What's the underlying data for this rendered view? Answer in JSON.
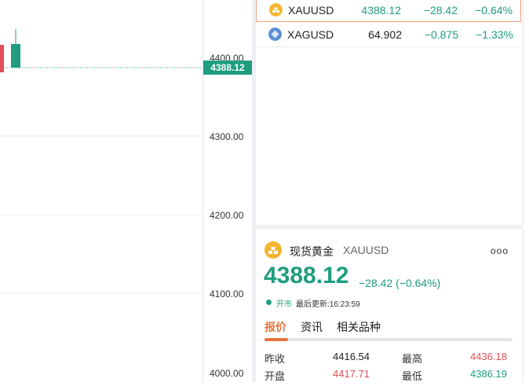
{
  "chart": {
    "axis_ticks": [
      "4300.00",
      "4200.00",
      "4100.00"
    ],
    "partial_top_tick": "4400.00",
    "partial_bottom_tick": "4000.00",
    "current_price_label": "4388.12",
    "colors": {
      "up": "#1f9d7f",
      "down": "#e0505a"
    }
  },
  "watchlist": {
    "rows": [
      {
        "symbol": "XAUUSD",
        "price": "4388.12",
        "change": "−28.42",
        "pct": "−0.64%",
        "icon": "gold-bars-icon",
        "selected": true
      },
      {
        "symbol": "XAGUSD",
        "price": "64.902",
        "change": "−0.875",
        "pct": "−1.33%",
        "icon": "silver-diamond-icon",
        "selected": false
      }
    ]
  },
  "detail": {
    "name": "现货黄金",
    "symbol": "XAUUSD",
    "more": "ooo",
    "price": "4388.12",
    "change": "−28.42 (−0.64%)",
    "status": "开市",
    "updated": "最后更新:16:23:59",
    "tabs": [
      "报价",
      "资讯",
      "相关品种"
    ],
    "quotes": [
      {
        "label": "昨收",
        "value": "4416.54"
      },
      {
        "label": "最高",
        "value": "4436.18"
      },
      {
        "label": "开盘",
        "value": "4417.71"
      },
      {
        "label": "最低",
        "value": "4386.19"
      }
    ],
    "colors": {
      "accent": "#e8743b",
      "up": "#1f9d7f",
      "down": "#e0505a"
    }
  }
}
